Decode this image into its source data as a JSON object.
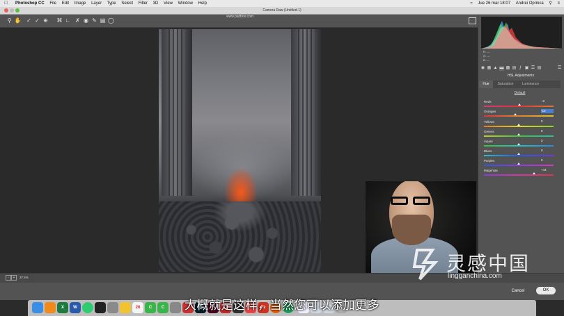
{
  "menubar": {
    "app": "Photoshop CC",
    "menus": [
      "File",
      "Edit",
      "Image",
      "Layer",
      "Type",
      "Select",
      "Filter",
      "3D",
      "View",
      "Window",
      "Help"
    ],
    "datetime": "Jue 26 mar  18:07",
    "user": "Andrei Oprinca"
  },
  "dialog": {
    "title": "Camera Raw (Untitled-1)"
  },
  "preview": {
    "url": "www.psdbox.com",
    "zoom": "37.5%"
  },
  "panel": {
    "rgb_readout": [
      "R:  ---",
      "G:  ---",
      "B:  ---"
    ],
    "title": "HSL Adjustments",
    "tabs": [
      "Hue",
      "Saturation",
      "Luminance"
    ],
    "active_tab": "Hue",
    "default_link": "Default",
    "sliders": [
      {
        "label": "Reds",
        "value": "+2",
        "fraction": 0.51,
        "active": false
      },
      {
        "label": "Oranges",
        "value": "-10",
        "fraction": 0.45,
        "active": true
      },
      {
        "label": "Yellows",
        "value": "0",
        "fraction": 0.5,
        "active": false
      },
      {
        "label": "Greens",
        "value": "0",
        "fraction": 0.5,
        "active": false
      },
      {
        "label": "Aquas",
        "value": "0",
        "fraction": 0.5,
        "active": false
      },
      {
        "label": "Blues",
        "value": "0",
        "fraction": 0.5,
        "active": false
      },
      {
        "label": "Purples",
        "value": "0",
        "fraction": 0.5,
        "active": false
      },
      {
        "label": "Magentas",
        "value": "+44",
        "fraction": 0.72,
        "active": false
      }
    ]
  },
  "footer": {
    "cancel": "Cancel",
    "ok": "OK"
  },
  "subtitle": "大概就是这样，当然您可以添加更多",
  "watermark": {
    "text": "灵感中国",
    "url": "lingganchina.com"
  },
  "colors": {
    "accent": "#4a7fd0",
    "panel_bg": "#535353",
    "fire": "#ff5a14"
  }
}
